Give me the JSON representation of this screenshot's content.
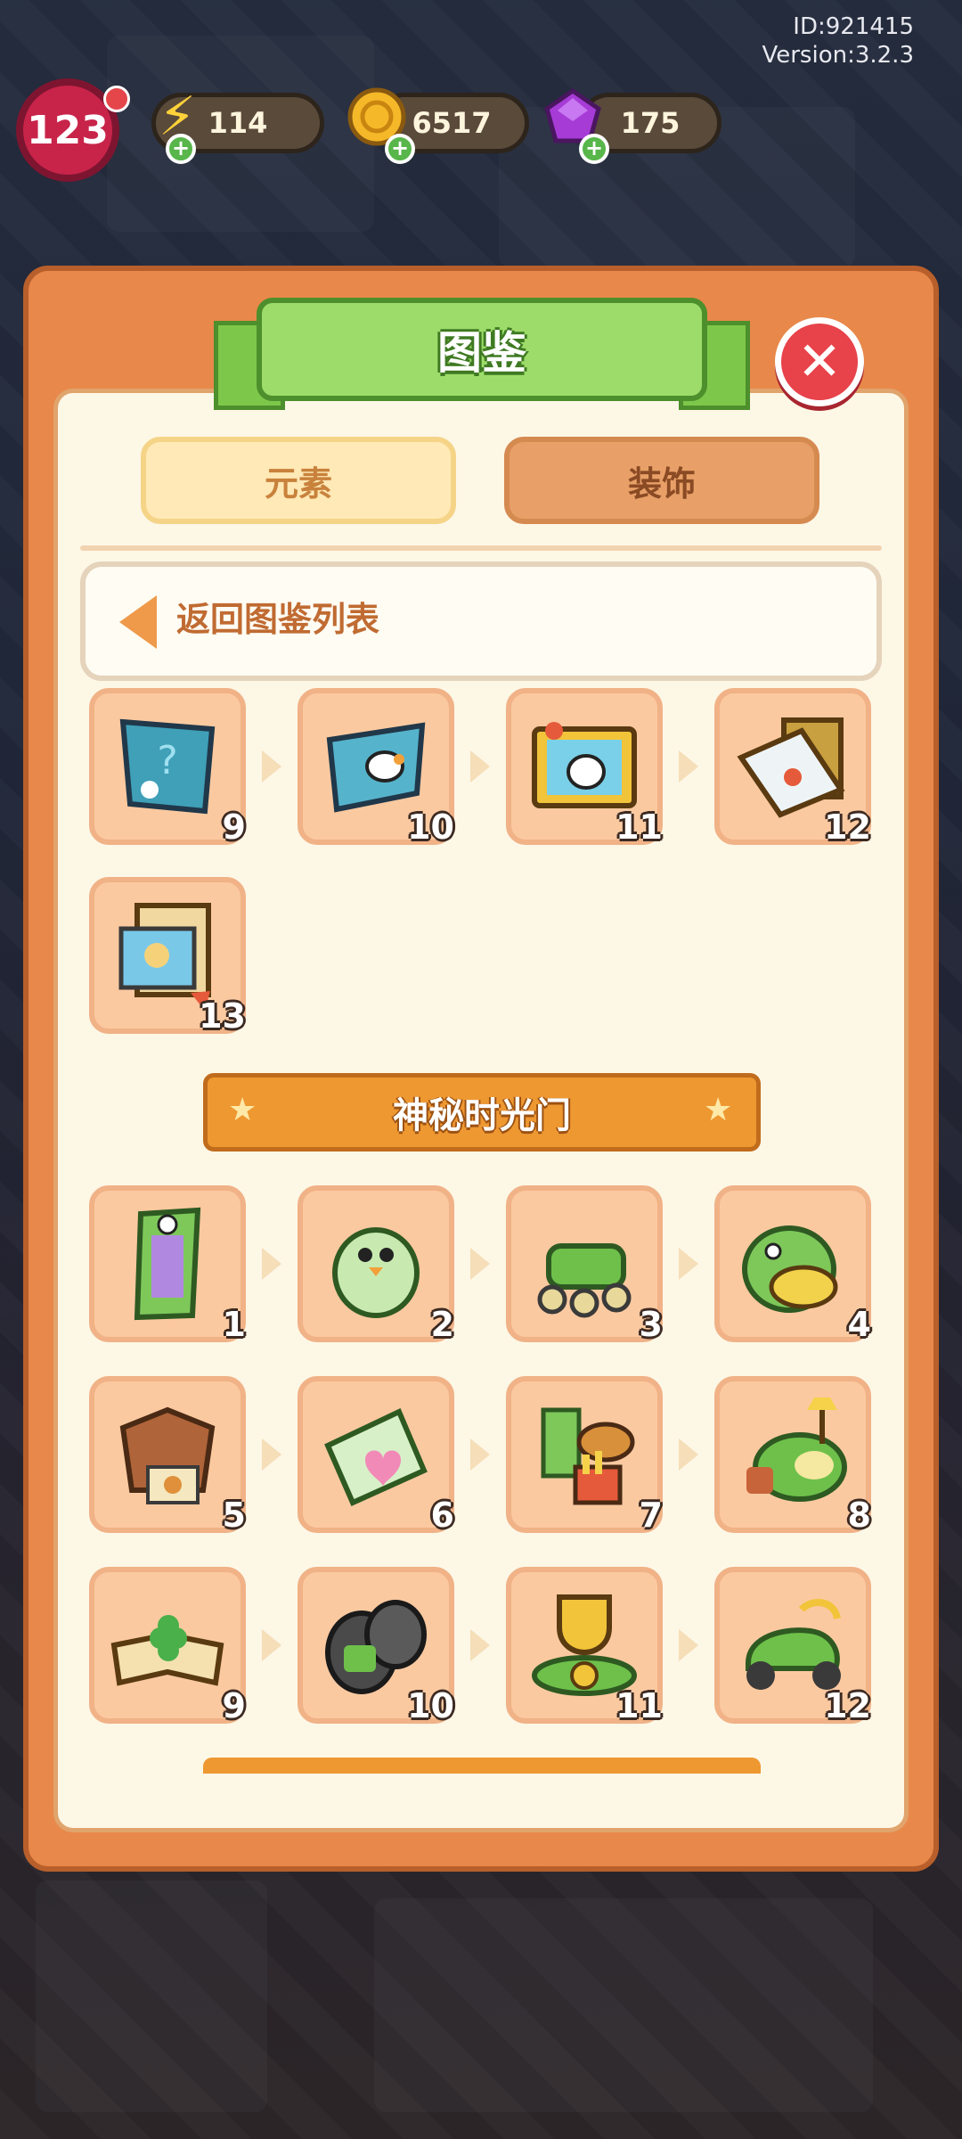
{
  "meta": {
    "id": "ID:921415",
    "version": "Version:3.2.3"
  },
  "hud": {
    "level": "123",
    "energy": "114",
    "coins": "6517",
    "gems": "175"
  },
  "dialog": {
    "title": "图鉴",
    "tabs": [
      "元素",
      "装饰"
    ],
    "active_tab": "元素",
    "back_label": "返回图鉴列表"
  },
  "chain_1": [
    {
      "name": "teal-wrapping-paper",
      "level": "9"
    },
    {
      "name": "wrapped-paper-with-goose",
      "level": "10"
    },
    {
      "name": "framed-goose-photo",
      "level": "11"
    },
    {
      "name": "envelope-with-frame",
      "level": "12"
    },
    {
      "name": "stamp-photo-stack",
      "level": "13"
    }
  ],
  "section_title": "神秘时光门",
  "chain_2": [
    {
      "name": "green-time-door",
      "level": "1"
    },
    {
      "name": "cracked-egg",
      "level": "2"
    },
    {
      "name": "green-toy-car",
      "level": "3"
    },
    {
      "name": "dino-backpack",
      "level": "4"
    },
    {
      "name": "leaf-coat-with-photo",
      "level": "5"
    },
    {
      "name": "torn-heart-letter",
      "level": "6"
    },
    {
      "name": "fast-food-meal",
      "level": "7"
    },
    {
      "name": "melon-bed-with-lamp",
      "level": "8"
    },
    {
      "name": "clover-book",
      "level": "9"
    },
    {
      "name": "boxing-gloves",
      "level": "10"
    },
    {
      "name": "trophy-and-belt",
      "level": "11"
    },
    {
      "name": "green-scooter",
      "level": "12"
    }
  ],
  "colors": {
    "dialog": "#e8884a",
    "panel": "#fdf7e6",
    "tile": "#fbc9a0",
    "title_green": "#9ddc6a",
    "close_red": "#e8424a",
    "section_orange": "#ee9832"
  }
}
